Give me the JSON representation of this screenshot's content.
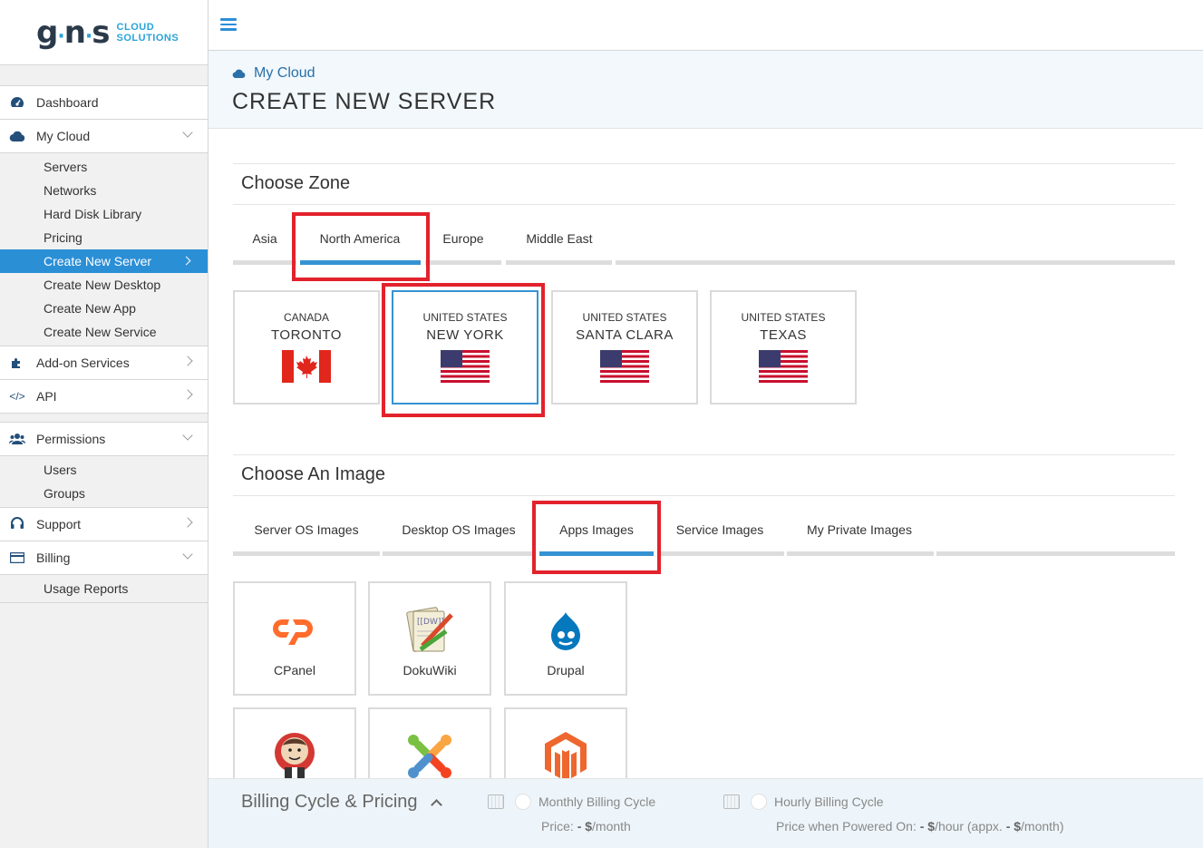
{
  "logo": {
    "mark": "gns",
    "line1": "CLOUD",
    "line2": "SOLUTIONS"
  },
  "nav": {
    "dashboard": "Dashboard",
    "my_cloud": "My Cloud",
    "my_cloud_sub": [
      "Servers",
      "Networks",
      "Hard Disk Library",
      "Pricing",
      "Create New Server",
      "Create New Desktop",
      "Create New App",
      "Create New Service"
    ],
    "addon": "Add-on Services",
    "api": "API",
    "permissions": "Permissions",
    "permissions_sub": [
      "Users",
      "Groups"
    ],
    "support": "Support",
    "billing": "Billing",
    "billing_sub": [
      "Usage Reports"
    ],
    "active_item": "Create New Server"
  },
  "header": {
    "breadcrumb": "My Cloud",
    "title": "CREATE NEW SERVER"
  },
  "zone": {
    "title": "Choose Zone",
    "tabs": [
      "Asia",
      "North America",
      "Europe",
      "Middle East"
    ],
    "active_tab": "North America",
    "locations": [
      {
        "country": "CANADA",
        "city": "TORONTO",
        "flag": "canada-flag"
      },
      {
        "country": "UNITED STATES",
        "city": "NEW YORK",
        "flag": "us-flag"
      },
      {
        "country": "UNITED STATES",
        "city": "SANTA CLARA",
        "flag": "us-flag"
      },
      {
        "country": "UNITED STATES",
        "city": "TEXAS",
        "flag": "us-flag"
      }
    ],
    "selected_location": "NEW YORK"
  },
  "image": {
    "title": "Choose An Image",
    "tabs": [
      "Server OS Images",
      "Desktop OS Images",
      "Apps Images",
      "Service Images",
      "My Private Images"
    ],
    "active_tab": "Apps Images",
    "apps": [
      {
        "name": "CPanel",
        "icon": "cpanel-logo"
      },
      {
        "name": "DokuWiki",
        "icon": "dokuwiki-logo"
      },
      {
        "name": "Drupal",
        "icon": "drupal-logo"
      },
      {
        "name": "",
        "icon": "jenkins-logo"
      },
      {
        "name": "",
        "icon": "joomla-logo"
      },
      {
        "name": "",
        "icon": "magento-logo"
      }
    ]
  },
  "billing": {
    "title": "Billing Cycle & Pricing",
    "monthly_label": "Monthly Billing Cycle",
    "monthly_price_prefix": "Price: ",
    "monthly_price_value": "- $",
    "monthly_price_suffix": "/month",
    "hourly_label": "Hourly Billing Cycle",
    "hourly_price_prefix": "Price when Powered On: ",
    "hourly_price_value": "- $",
    "hourly_price_mid": "/hour (appx. ",
    "hourly_price_value2": "- $",
    "hourly_price_suffix": "/month)"
  },
  "colors": {
    "accent": "#2b8fd6",
    "highlight": "#e2222c",
    "tab_active": "#3593d3"
  }
}
